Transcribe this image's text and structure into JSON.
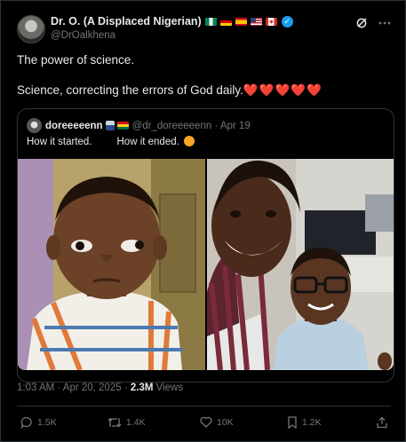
{
  "author": {
    "name": "Dr. O. (A Displaced Nigerian)",
    "flags": [
      "nigeria-flag",
      "germany-flag",
      "spain-flag",
      "usa-flag",
      "canada-flag"
    ],
    "verified": true,
    "handle": "@DrOalkhena"
  },
  "tweet": {
    "line1": "The power of science.",
    "line2": "Science, correcting the errors of God daily.",
    "hearts": "❤️❤️❤️❤️❤️"
  },
  "quoted": {
    "name": "doreeeeenn",
    "handle_time": "@dr_doreeeeenn · Apr 19",
    "text_a": "How it started.",
    "text_b": "How it ended."
  },
  "meta": {
    "time": "1:03 AM · Apr 20, 2025 · ",
    "views_count": "2.3M",
    "views_label": " Views"
  },
  "actions": {
    "replies": "1.5K",
    "reposts": "1.4K",
    "likes": "10K",
    "bookmarks": "1.2K"
  },
  "colors": {
    "background": "#000000",
    "text": "#e7e9ea",
    "muted": "#71767b",
    "border": "#2f3336",
    "accent": "#1d9bf0",
    "heart": "#e8244a"
  }
}
